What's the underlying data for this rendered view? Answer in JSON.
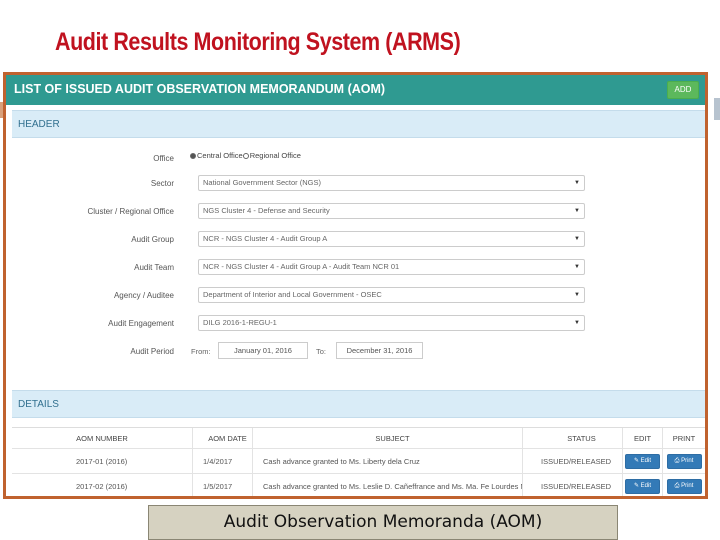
{
  "slide": {
    "title": "Audit Results Monitoring System (ARMS)",
    "caption": "Audit Observation Memoranda (AOM)",
    "title_color": "#c0121f",
    "frame_color": "#c0622f"
  },
  "app_bar": {
    "title": "LIST OF ISSUED AUDIT OBSERVATION MEMORANDUM (AOM)",
    "add_label": "ADD",
    "color": "#2f9a91"
  },
  "header_section": {
    "label": "HEADER",
    "office": {
      "label": "Office",
      "option_central": "Central Office",
      "option_regional": "Regional Office"
    },
    "sector": {
      "label": "Sector",
      "value": "National Government Sector (NGS)"
    },
    "cluster": {
      "label": "Cluster / Regional Office",
      "value": "NGS Cluster 4 - Defense and Security"
    },
    "audit_group": {
      "label": "Audit Group",
      "value": "NCR - NGS Cluster 4 - Audit Group A"
    },
    "audit_team": {
      "label": "Audit Team",
      "value": "NCR - NGS Cluster 4 - Audit Group A - Audit Team NCR 01"
    },
    "agency": {
      "label": "Agency / Auditee",
      "value": "Department of Interior and Local Government - OSEC"
    },
    "engagement": {
      "label": "Audit Engagement",
      "value": "DILG 2016-1-REGU-1"
    },
    "period": {
      "label": "Audit Period",
      "from_label": "From:",
      "from_value": "January 01, 2016",
      "to_label": "To:",
      "to_value": "December 31, 2016"
    }
  },
  "details_section": {
    "label": "DETAILS",
    "columns": [
      "AOM NUMBER",
      "AOM DATE",
      "SUBJECT",
      "STATUS",
      "EDIT",
      "PRINT"
    ],
    "rows": [
      {
        "number": "2017-01 (2016)",
        "date": "1/4/2017",
        "subject": "Cash advance granted to Ms. Liberty dela Cruz",
        "status": "ISSUED/RELEASED",
        "edit": "Edit",
        "print": "Print"
      },
      {
        "number": "2017-02 (2016)",
        "date": "1/5/2017",
        "subject": "Cash advance granted to Ms. Leslie D. Cañeffrance and Ms. Ma. Fe Lourdes M.",
        "status": "ISSUED/RELEASED",
        "edit": "Edit",
        "print": "Print"
      }
    ]
  }
}
